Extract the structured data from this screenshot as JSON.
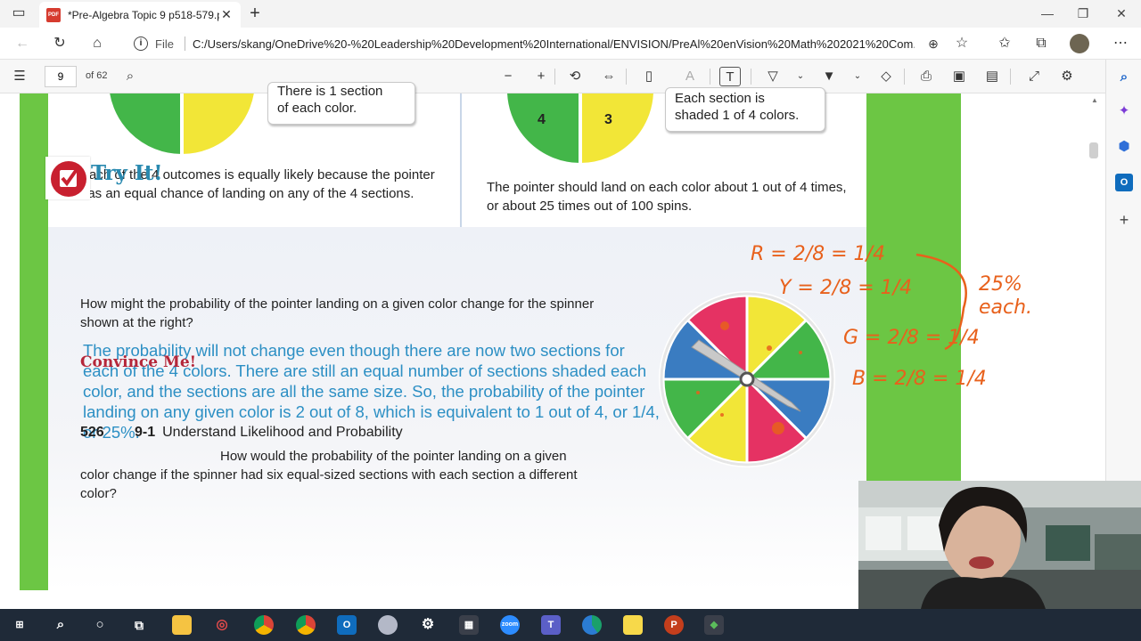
{
  "browser": {
    "tab_title": "*Pre-Algebra Topic 9 p518-579.p",
    "tab_close": "✕",
    "new_tab": "+",
    "file_label": "File",
    "url": "C:/Users/skang/OneDrive%20-%20Leadership%20Development%20International/ENVISION/PreAl%20enVision%20Math%202021%20Com...",
    "window_controls": [
      "—",
      "❐",
      "✕"
    ]
  },
  "pdf_toolbar": {
    "page_number": "9",
    "page_of": "of 62"
  },
  "page": {
    "callout_left": "There is 1 section\nof each color.",
    "callout_right": "Each section is\nshaded 1 of 4 colors.",
    "spinner_right_labels": [
      "4",
      "3"
    ],
    "left_text": "Each of the 4 outcomes is equally likely because the pointer has an equal chance of landing on any of the 4 sections.",
    "right_text": "The pointer should land on each color about 1 out of 4 times, or about 25 times out of 100 spins.",
    "try_it_title": "Try It!",
    "try_it_question": "How might the probability of the pointer landing on a given color change for the spinner shown at the right?",
    "answer": "The probability will not change even though there are now two sections for each of the 4 colors. There are still an equal number of sections shaded each color, and the sections are all the same size. So, the probability of the pointer landing on any given color is 2 out of 8, which is equivalent to 1 out of 4, or 1/4, or 25%.",
    "convince_title": "Convince Me!",
    "convince_text": "How would the probability of the pointer landing on a given color change if the spinner had six equal-sized sections with each section a different color?",
    "page_number": "526",
    "lesson_number": "9-1",
    "lesson_title": "Understand Likelihood and Probability"
  },
  "annotations": {
    "lines": [
      "R = 2/8 = 1/4",
      "Y = 2/8 = 1/4",
      "G = 2/8 = 1/4",
      "B = 2/8 = 1/4"
    ],
    "note_line1": "25%",
    "note_line2": "each.",
    "ink_color": "#e8611c"
  },
  "colors": {
    "green_band": "#6cc644",
    "answer_blue": "#2c8fc4",
    "try_teal": "#2a8ab0",
    "convince_red": "#b5273a",
    "spinner_red": "#e53263",
    "spinner_yellow": "#f2e637",
    "spinner_green": "#43b649",
    "spinner_blue": "#3a7cc1"
  },
  "taskbar_icons": [
    "windows-icon",
    "search-icon",
    "cortana-icon",
    "task-view-icon",
    "file-explorer-icon",
    "feedback-icon",
    "chrome-icon",
    "chrome-profile-icon",
    "outlook-icon",
    "snip-icon",
    "settings-icon",
    "calculator-icon",
    "zoom-icon",
    "teams-icon",
    "edge-icon",
    "sticky-notes-icon",
    "powerpoint-icon",
    "geogebra-icon"
  ]
}
